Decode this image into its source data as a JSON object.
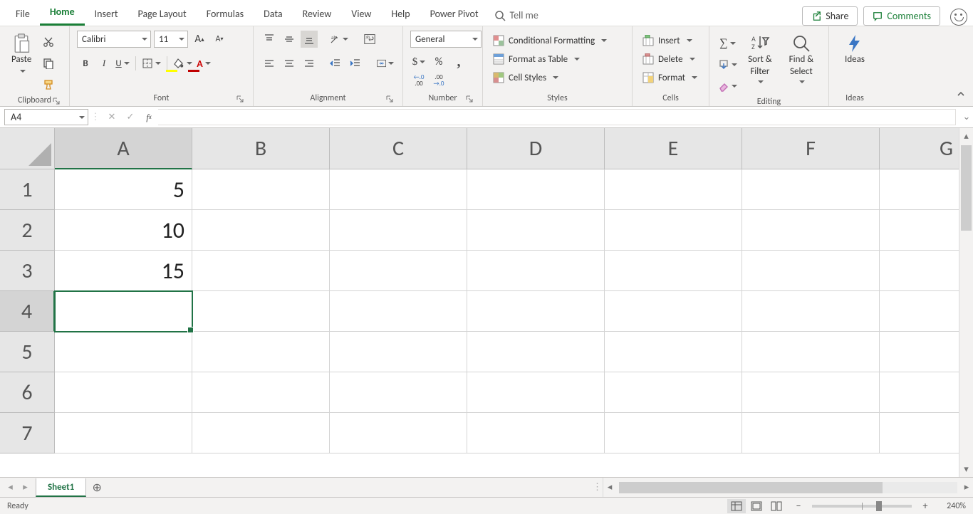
{
  "tabs": {
    "items": [
      "File",
      "Home",
      "Insert",
      "Page Layout",
      "Formulas",
      "Data",
      "Review",
      "View",
      "Help",
      "Power Pivot"
    ],
    "active": "Home",
    "share": "Share",
    "comments": "Comments",
    "tellme": "Tell me"
  },
  "ribbon": {
    "clipboard": {
      "label": "Clipboard",
      "paste": "Paste"
    },
    "font": {
      "label": "Font",
      "name": "Calibri",
      "size": "11",
      "increase": "A",
      "decrease": "A",
      "bold": "B",
      "italic": "I",
      "underline": "U"
    },
    "alignment": {
      "label": "Alignment",
      "wrap": "ab"
    },
    "number": {
      "label": "Number",
      "format": "General",
      "currency": "$",
      "percent": "%",
      "comma": ",",
      "inc": ".00",
      "dec": ".00"
    },
    "styles": {
      "label": "Styles",
      "cond": "Conditional Formatting",
      "table": "Format as Table",
      "cell": "Cell Styles"
    },
    "cells": {
      "label": "Cells",
      "insert": "Insert",
      "delete": "Delete",
      "format": "Format"
    },
    "editing": {
      "label": "Editing",
      "sort1": "Sort &",
      "sort2": "Filter",
      "find1": "Find &",
      "find2": "Select"
    },
    "ideas": {
      "label": "Ideas",
      "btn": "Ideas"
    }
  },
  "fxbar": {
    "name": "A4",
    "formula": ""
  },
  "grid": {
    "columns": [
      "A",
      "B",
      "C",
      "D",
      "E",
      "F",
      "G"
    ],
    "rows": [
      "1",
      "2",
      "3",
      "4",
      "5",
      "6",
      "7"
    ],
    "activeCol": "A",
    "activeRow": "4",
    "cells": {
      "A1": "5",
      "A2": "10",
      "A3": "15"
    }
  },
  "sheets": {
    "active": "Sheet1"
  },
  "status": {
    "ready": "Ready",
    "zoom": "240%"
  }
}
